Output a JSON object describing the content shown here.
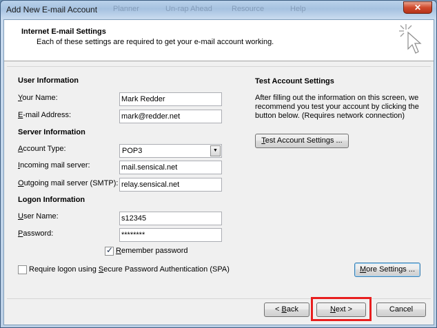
{
  "window": {
    "title": "Add New E-mail Account",
    "close_glyph": "✕",
    "background_items": [
      "Planner",
      "Un-rap Ahead",
      "Resource",
      "Help"
    ]
  },
  "header": {
    "title": "Internet E-mail Settings",
    "subtitle": "Each of these settings are required to get your e-mail account working."
  },
  "user_info": {
    "section": "User Information",
    "name_label_u": "Y",
    "name_label_rest": "our Name:",
    "name_value": "Mark Redder",
    "email_label_u": "E",
    "email_label_rest": "-mail Address:",
    "email_value": "mark@redder.net"
  },
  "server_info": {
    "section": "Server Information",
    "account_type_label_u": "A",
    "account_type_label_rest": "ccount Type:",
    "account_type_value": "POP3",
    "incoming_label_u": "I",
    "incoming_label_rest": "ncoming mail server:",
    "incoming_value": "mail.sensical.net",
    "outgoing_label_u": "O",
    "outgoing_label_rest": "utgoing mail server (SMTP):",
    "outgoing_value": "relay.sensical.net"
  },
  "logon_info": {
    "section": "Logon Information",
    "username_label_u": "U",
    "username_label_rest": "ser Name:",
    "username_value": "s12345",
    "password_label_u": "P",
    "password_label_rest": "assword:",
    "password_value": "********",
    "remember_label_u": "R",
    "remember_label_rest": "emember password",
    "remember_checked": true,
    "spa_label_pre": "Require logon using ",
    "spa_label_u": "S",
    "spa_label_rest": "ecure Password Authentication (SPA)",
    "spa_checked": false
  },
  "test": {
    "section": "Test Account Settings",
    "description": "After filling out the information on this screen, we recommend you test your account by clicking the button below. (Requires network connection)",
    "button_u": "T",
    "button_rest": "est Account Settings ..."
  },
  "more_settings": {
    "u": "M",
    "rest": "ore Settings ..."
  },
  "nav": {
    "back_pre": "< ",
    "back_u": "B",
    "back_rest": "ack",
    "next_u": "N",
    "next_rest": "ext >",
    "cancel": "Cancel"
  },
  "colors": {
    "highlight": "#e81e1e",
    "accent": "#3c7fb1"
  }
}
